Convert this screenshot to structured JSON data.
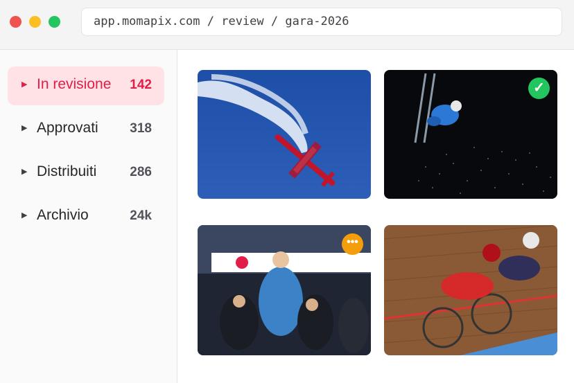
{
  "window": {
    "url": "app.momapix.com / review / gara-2026"
  },
  "sidebar": {
    "items": [
      {
        "label": "In revisione",
        "count": "142",
        "active": true
      },
      {
        "label": "Approvati",
        "count": "318",
        "active": false
      },
      {
        "label": "Distribuiti",
        "count": "286",
        "active": false
      },
      {
        "label": "Archivio",
        "count": "24k",
        "active": false
      }
    ]
  },
  "gallery": {
    "photos": [
      {
        "subject": "aerobatic plane with smoke trail",
        "status": "none"
      },
      {
        "subject": "freestyle skier mid-air at night",
        "status": "approved"
      },
      {
        "subject": "snowboard world championships podium celebration",
        "status": "more"
      },
      {
        "subject": "track cycling race",
        "status": "none"
      }
    ],
    "approved_icon": "✓",
    "more_icon": "•••"
  },
  "colors": {
    "accent": "#e11d48",
    "active_bg": "#fee2e6",
    "approved": "#22c55e",
    "more": "#f59e0b"
  }
}
